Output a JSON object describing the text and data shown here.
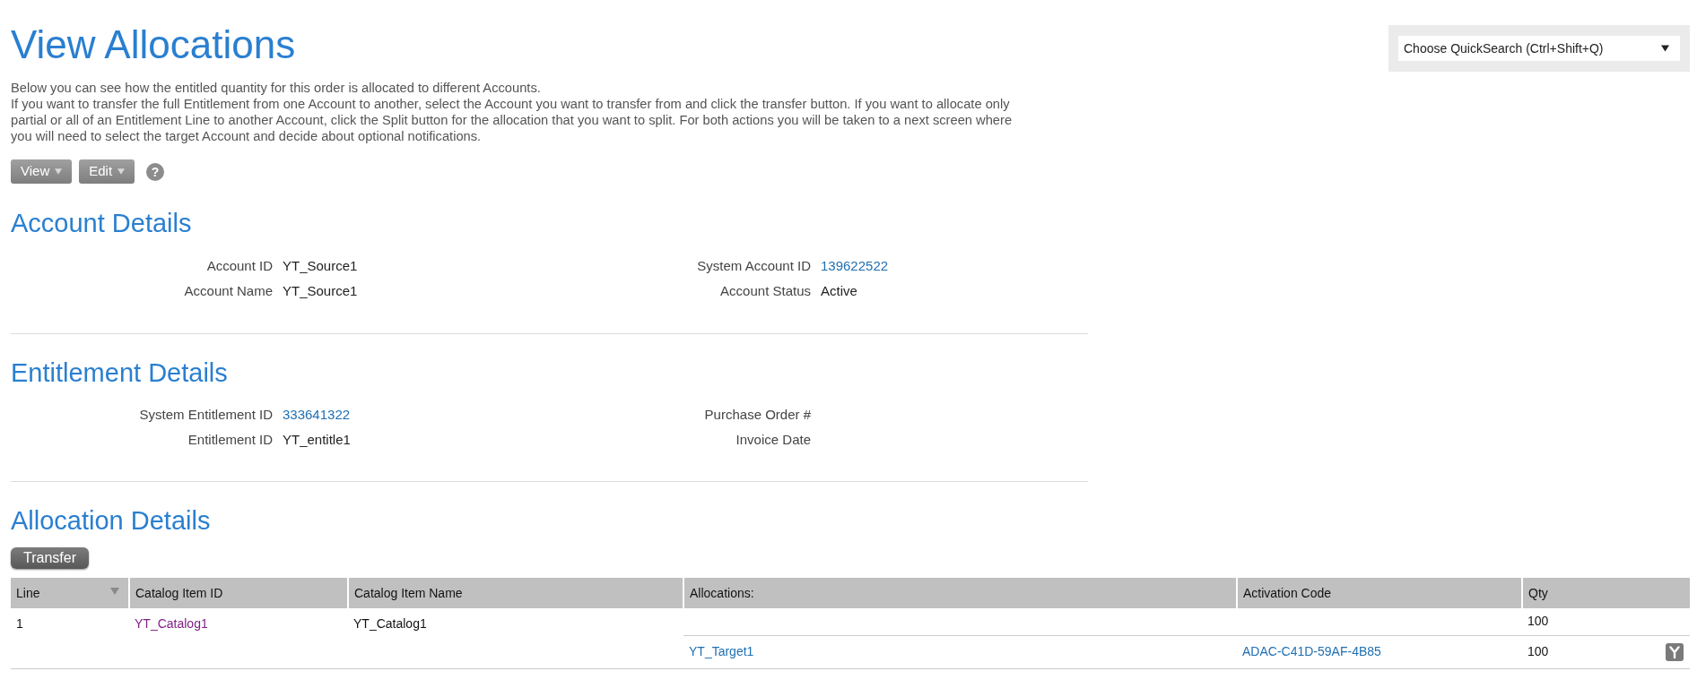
{
  "page": {
    "title": "View Allocations",
    "description": [
      "Below you can see how the entitled quantity for this order is allocated to different Accounts.",
      "If you want to transfer the full Entitlement from one Account to another, select the Account you want to transfer from and click the transfer button. If you want to allocate only partial or all of an Entitlement Line to another Account, click the Split button for the allocation that you want to split. For both actions you will be taken to a next screen where you will need to select the target Account and decide about optional notifications."
    ]
  },
  "quicksearch": {
    "value": "Choose QuickSearch (Ctrl+Shift+Q)"
  },
  "toolbar": [
    {
      "kind": "menu",
      "label": "View"
    },
    {
      "kind": "menu",
      "label": "Edit"
    },
    {
      "kind": "help",
      "label": "?"
    }
  ],
  "account_details": {
    "title": "Account Details",
    "rows": [
      [
        {
          "label": "Account ID",
          "kind": "text",
          "value": "YT_Source1"
        },
        {
          "label": "System Account ID",
          "kind": "link",
          "value": "139622522"
        }
      ],
      [
        {
          "label": "Account Name",
          "kind": "text",
          "value": "YT_Source1"
        },
        {
          "label": "Account Status",
          "kind": "text",
          "value": "Active"
        }
      ]
    ]
  },
  "entitlement_details": {
    "title": "Entitlement Details",
    "rows": [
      [
        {
          "label": "System Entitlement ID",
          "kind": "link",
          "value": "333641322"
        },
        {
          "label": "Purchase Order #"
        }
      ],
      [
        {
          "label": "Entitlement ID",
          "kind": "text",
          "value": "YT_entitle1"
        },
        {
          "label": "Invoice Date"
        }
      ]
    ]
  },
  "allocation_details": {
    "title": "Allocation Details",
    "transfer_button": "Transfer",
    "table": {
      "columns": [
        {
          "label": "Line",
          "sorted": true
        },
        {
          "label": "Catalog Item ID",
          "sorted": false
        },
        {
          "label": "Catalog Item Name",
          "sorted": false
        },
        {
          "label": "Allocations:",
          "sorted": false
        },
        {
          "label": "Activation Code",
          "sorted": false
        },
        {
          "label": "Qty",
          "sorted": false
        }
      ],
      "lines": [
        {
          "line": "1",
          "catalog_item_id": {
            "text": "YT_Catalog1",
            "visited": true
          },
          "catalog_item_name": "YT_Catalog1",
          "qty": "100",
          "allocations": [
            {
              "account": "YT_Target1",
              "activation_code": "ADAC-C41D-59AF-4B85",
              "qty": "100"
            }
          ]
        }
      ]
    }
  }
}
